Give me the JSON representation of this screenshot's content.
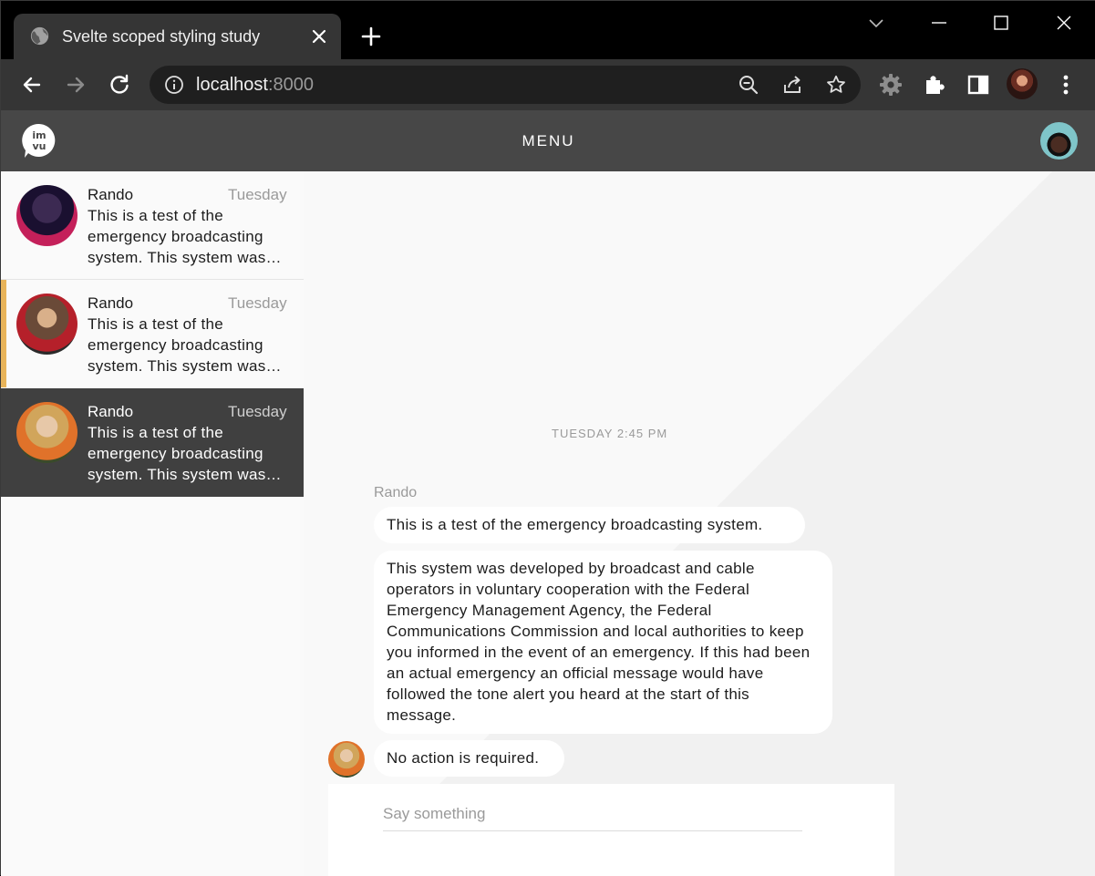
{
  "browser": {
    "tab_title": "Svelte scoped styling study",
    "url_host": "localhost",
    "url_port": ":8000"
  },
  "app": {
    "menu_label": "MENU"
  },
  "conversations": [
    {
      "name": "Rando",
      "date": "Tuesday",
      "preview": "This is a test of the emergency broadcasting system. This system was…"
    },
    {
      "name": "Rando",
      "date": "Tuesday",
      "preview": "This is a test of the emergency broadcasting system. This system was…"
    },
    {
      "name": "Rando",
      "date": "Tuesday",
      "preview": "This is a test of the emergency broadcasting system. This system was…"
    }
  ],
  "chat": {
    "timestamp": "TUESDAY 2:45 PM",
    "sender": "Rando",
    "messages": [
      "This is a test of the emergency broadcasting system.",
      "This system was developed by broadcast and cable operators in voluntary cooperation with the Federal Emergency Management Agency, the Federal Communications Commission and local authorities to keep you informed in the event of an emergency. If this had been an actual emergency an official message would have followed the tone alert you heard at the start of this message.",
      "No action is required."
    ],
    "composer_placeholder": "Say something"
  },
  "colors": {
    "header_bg": "#474747",
    "selected_conv_bg": "#404040",
    "accent_bar": "#e8b45a",
    "bubble_bg": "#ffffff"
  },
  "icons": [
    "globe-icon",
    "close-icon",
    "plus-icon",
    "chevron-down-icon",
    "minimize-icon",
    "maximize-icon",
    "window-close-icon",
    "back-arrow-icon",
    "forward-arrow-icon",
    "reload-icon",
    "info-icon",
    "zoom-out-icon",
    "share-icon",
    "star-icon",
    "gear-icon",
    "puzzle-icon",
    "sidebar-icon",
    "kebab-menu-icon",
    "imvu-logo"
  ]
}
